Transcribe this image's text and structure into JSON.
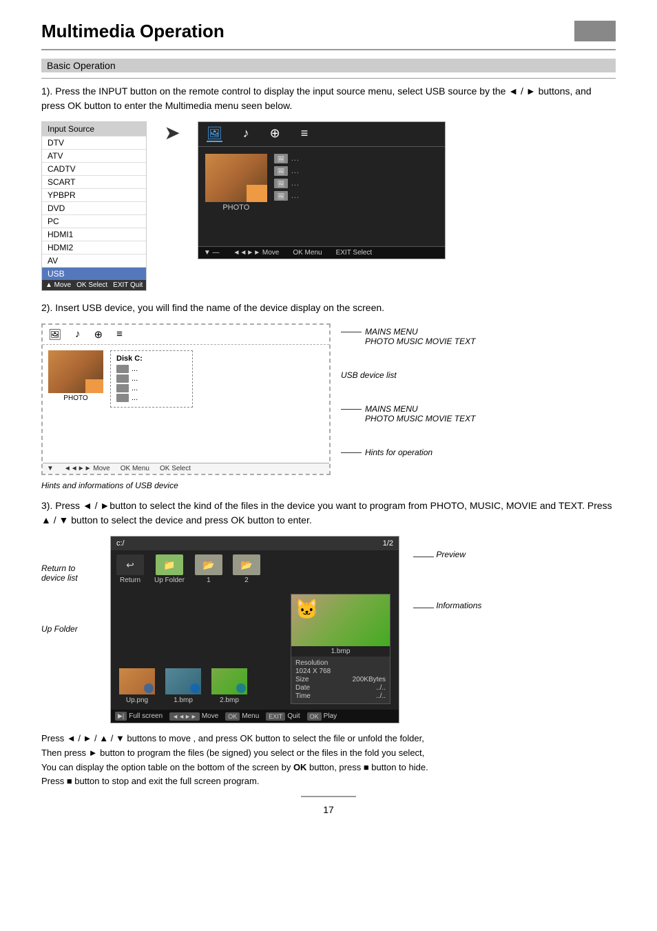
{
  "page": {
    "title": "Multimedia Operation",
    "page_number": "17",
    "corner_label": ""
  },
  "basic_operation": {
    "section_title": "Basic Operation",
    "para1": "1). Press the INPUT button on the remote control to display the input source menu, select USB source by the ◄ / ► buttons, and press OK button to enter the Multimedia menu seen below.",
    "input_source": {
      "header": "Input Source",
      "items": [
        "DTV",
        "ATV",
        "CADTV",
        "SCART",
        "YPBPR",
        "DVD",
        "PC",
        "HDMI1",
        "HDMI2",
        "AV",
        "USB"
      ],
      "highlight": "USB",
      "footer": [
        "▲ Move",
        "OK Select",
        "EXIT Quit"
      ]
    },
    "multimedia_icons": [
      "🖼",
      "♪",
      "⊕",
      "≡"
    ],
    "photo_label": "PHOTO",
    "file_items": [
      "...",
      "...",
      "...",
      "..."
    ],
    "multimedia_bottom": [
      "▼ —",
      "◄◄►► Move",
      "OK Menu",
      "EXIT Select"
    ],
    "para2": "2). Insert USB device, you will find the name of the device display on the screen.",
    "mains_menu_label": "MAINS MENU",
    "photo_music_movie_text": "PHOTO  MUSIC  MOVIE  TEXT",
    "usb_device_list_label": "USB device list",
    "hints_label": "Hints for operation",
    "hints_caption": "Hints and informations of USB device",
    "disk_label": "Disk C:",
    "usb_file_items": [
      "Disk C:",
      "...",
      "...",
      "..."
    ],
    "para3": "3). Press ◄ / ►button to select the kind of the files in the device you want to program from PHOTO, MUSIC, MOVIE and TEXT. Press ▲ / ▼ button to select the device and press OK button to enter.",
    "fb_top_left": "c:/",
    "fb_top_right": "1/2",
    "fb_toolbar_items": [
      "Return",
      "Up Folder",
      "1",
      "2"
    ],
    "fb_files": [
      "Up.png",
      "1.bmp",
      "2.bmp"
    ],
    "fb_preview_label": "1.bmp",
    "fb_info": {
      "resolution_label": "Resolution",
      "resolution_value": "1024 X 768",
      "size_label": "Size",
      "size_value": "200KBytes",
      "date_label": "Date",
      "date_value": "../..",
      "time_label": "Time",
      "time_value": "../.."
    },
    "fb_bottom": [
      "Full screen",
      "◄◄►► Move",
      "OK Menu",
      "EXIT Quit",
      "OK Play"
    ],
    "left_annotations": {
      "return_to_device_list": "Return to\ndevice list",
      "up_folder": "Up Folder"
    },
    "right_annotations": {
      "preview": "Preview",
      "informations": "Informations"
    },
    "bottom_text": "Press ◄ / ► / ▲ / ▼ buttons to move , and press OK button to select the file or unfold the folder,\nThen press ► button to program the files (be signed) you select or the files in the fold you select,\nYou can display the option table on the bottom of the screen by OK button, press ■ button to hide.\nPress ■ button to stop and exit the full screen program."
  }
}
